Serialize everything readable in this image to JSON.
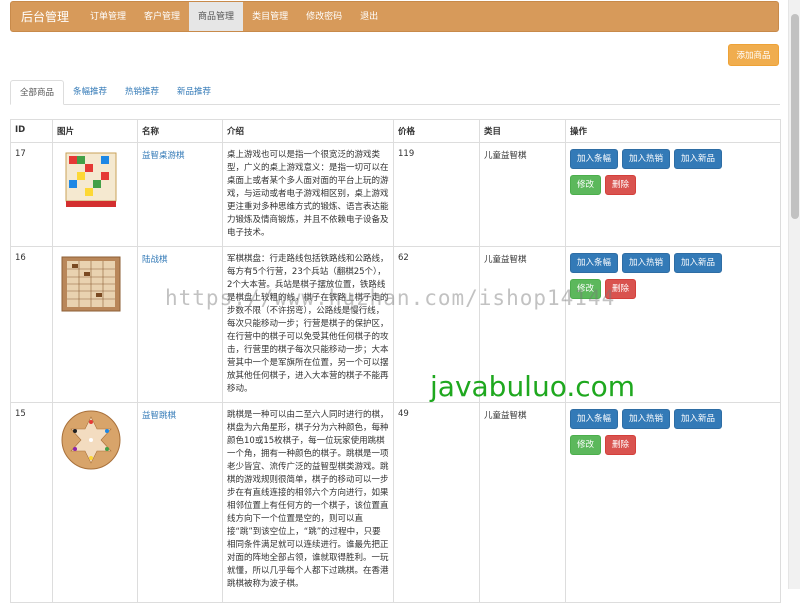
{
  "nav": {
    "brand": "后台管理",
    "items": [
      "订单管理",
      "客户管理",
      "商品管理",
      "类目管理",
      "修改密码",
      "退出"
    ],
    "active_index": 2
  },
  "add_button": "添加商品",
  "tabs": [
    "全部商品",
    "条幅推荐",
    "热销推荐",
    "新品推荐"
  ],
  "table": {
    "headers": [
      "ID",
      "图片",
      "名称",
      "介绍",
      "价格",
      "类目",
      "操作"
    ],
    "rows": [
      {
        "id": "17",
        "name": "益智桌游棋",
        "desc": "桌上游戏也可以是指一个很宽泛的游戏类型，广义的桌上游戏意义：是指一切可以在桌面上或者某个多人面对面的平台上玩的游戏，与运动或者电子游戏相区别，桌上游戏更注重对多种思维方式的锻炼、语言表达能力锻炼及情商锻炼，并且不依赖电子设备及电子技术。",
        "price": "119",
        "category": "儿童益智棋"
      },
      {
        "id": "16",
        "name": "陆战棋",
        "desc": "军棋棋盘：行走路线包括铁路线和公路线，每方有5个行营，23个兵站（翻棋25个），2个大本营。兵站是棋子摆放位置，铁路线是棋盘上较粗的线，棋子在铁路上棋子走的步数不限（不许拐弯），公路线是慢行线，每次只能移动一步；行营是棋子的保护区，在行营中的棋子可以免受其他任何棋子的攻击，行营里的棋子每次只能移动一步；大本营其中一个是军旗所在位置，另一个可以摆放其他任何棋子，进入大本营的棋子不能再移动。",
        "price": "62",
        "category": "儿童益智棋"
      },
      {
        "id": "15",
        "name": "益智跳棋",
        "desc": "跳棋是一种可以由二至六人同时进行的棋，棋盘为六角星形，棋子分为六种颜色，每种颜色10或15枚棋子，每一位玩家使用跳棋一个角，拥有一种颜色的棋子。跳棋是一项老少皆宜、流传广泛的益智型棋类游戏。跳棋的游戏规则很简单，棋子的移动可以一步步在有直线连接的相邻六个方向进行，如果相邻位置上有任何方的一个棋子，该位置直线方向下一个位置是空的，则可以直接“跳”到该空位上，“跳”的过程中，只要相同条件满足就可以连续进行。谁最先把正对面的阵地全部占领，谁就取得胜利。一玩就懂，所以几乎每个人都下过跳棋。在香港跳棋被称为波子棋。",
        "price": "49",
        "category": "儿童益智棋"
      }
    ],
    "actions": {
      "add_banner": "加入条幅",
      "add_hot": "加入热销",
      "add_new": "加入新品",
      "edit": "修改",
      "delete": "删除"
    }
  },
  "watermarks": {
    "url": "https://www.huzhan.com/ishop14144",
    "site": "javabuluo.com"
  }
}
